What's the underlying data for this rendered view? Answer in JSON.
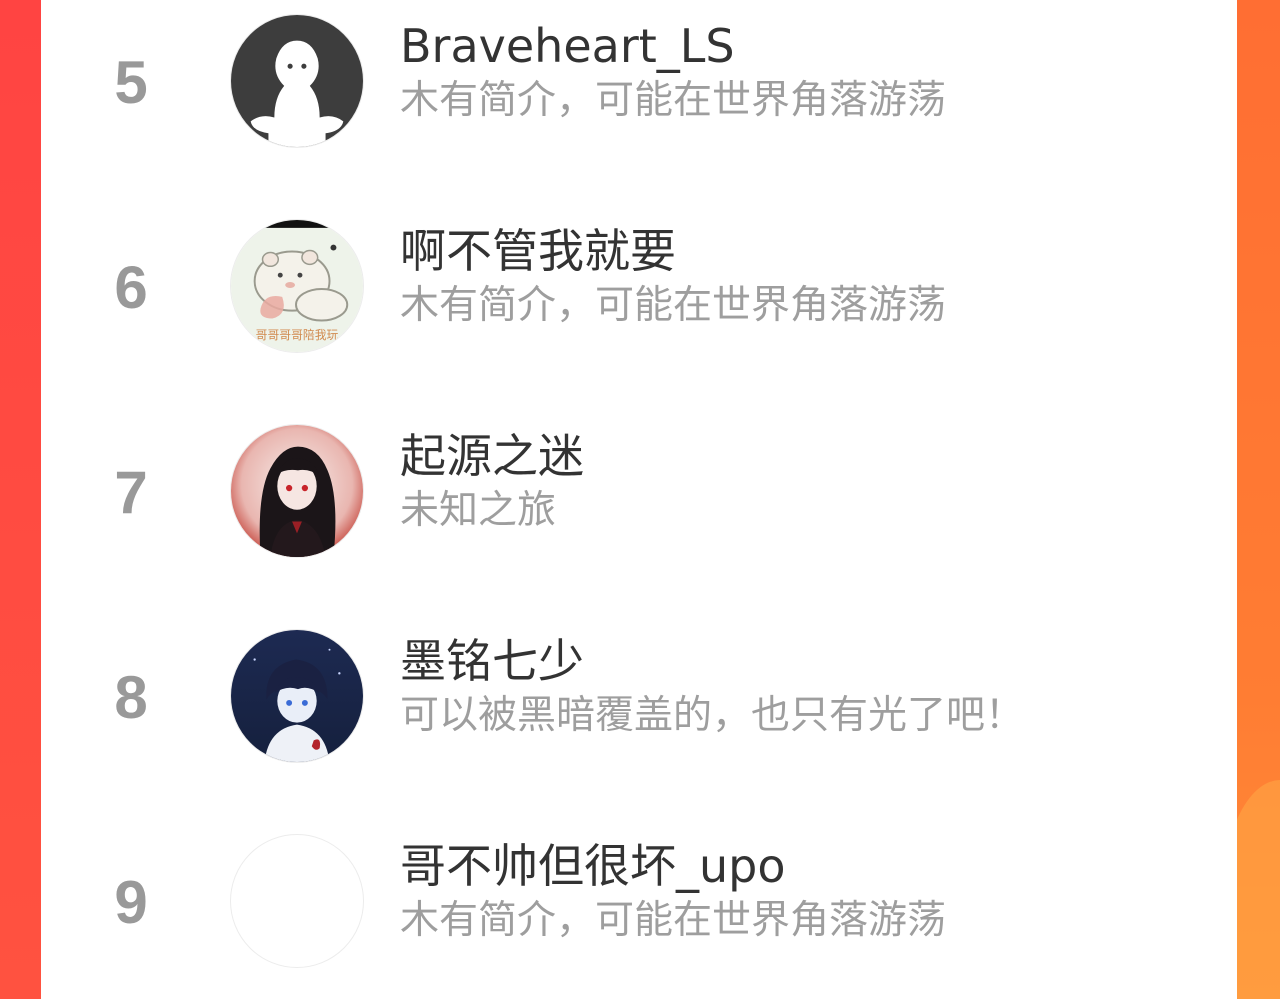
{
  "ranking": {
    "items": [
      {
        "rank": "5",
        "name": "Braveheart_LS",
        "bio": "木有简介，可能在世界角落游荡",
        "avatar": "default-ghost-avatar"
      },
      {
        "rank": "6",
        "name": "啊不管我就要",
        "bio": "木有简介，可能在世界角落游荡",
        "avatar": "hamster-avatar",
        "avatar_caption": "哥哥哥哥陪我玩"
      },
      {
        "rank": "7",
        "name": "起源之迷",
        "bio": "未知之旅",
        "avatar": "anime-girl-avatar"
      },
      {
        "rank": "8",
        "name": "墨铭七少",
        "bio": "可以被黑暗覆盖的，也只有光了吧！",
        "avatar": "anime-boy-avatar"
      },
      {
        "rank": "9",
        "name": "哥不帅但很坏_upo",
        "bio": "木有简介，可能在世界角落游荡",
        "avatar": "blank-avatar"
      }
    ]
  },
  "colors": {
    "background_left": "#ff4442",
    "background_right": "#ff7d33",
    "rank_text": "#999999",
    "name_text": "#333333",
    "bio_text": "#9e9e9e"
  }
}
